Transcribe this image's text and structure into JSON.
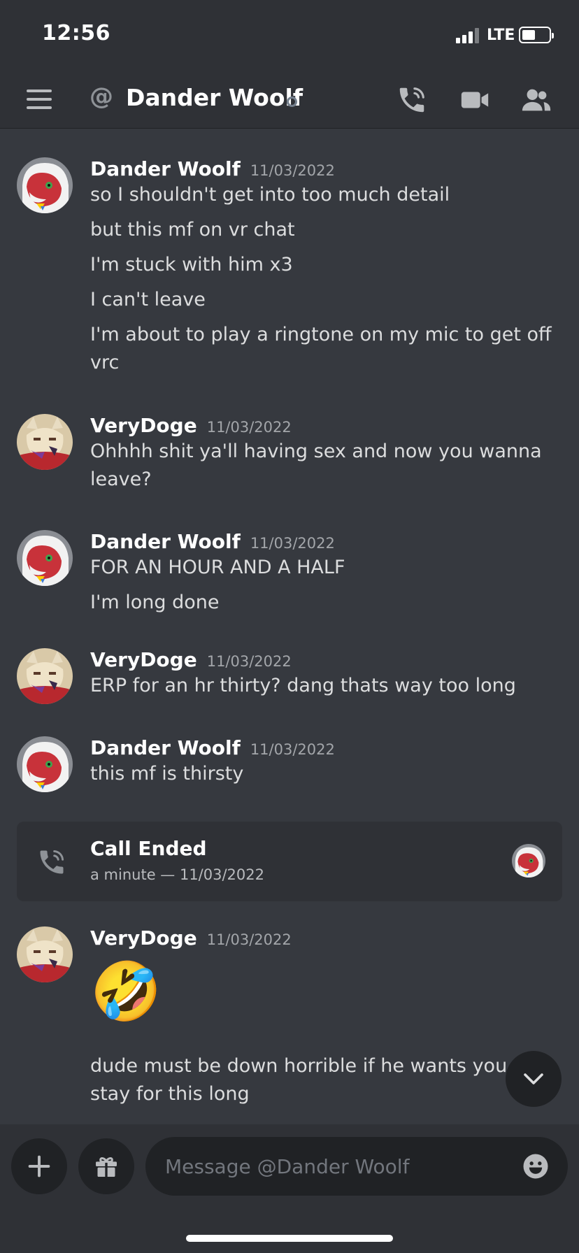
{
  "status_bar": {
    "time": "12:56",
    "network": "LTE"
  },
  "header": {
    "title": "Dander Woolf",
    "at_symbol": "@"
  },
  "colors": {
    "background": "#36393f",
    "header": "#2f3136",
    "input": "#202225",
    "presence_offline": "#747f8d"
  },
  "messages": [
    {
      "author": "Dander Woolf",
      "timestamp": "11/03/2022",
      "lines": [
        "so I shouldn't get into too much detail",
        "but this mf on vr chat",
        "I'm stuck with him x3",
        "I can't leave",
        "I'm about to play a ringtone on my mic to get off vrc"
      ]
    },
    {
      "author": "VeryDoge",
      "timestamp": "11/03/2022",
      "lines": [
        "Ohhhh shit ya'll having sex and now you wanna leave?"
      ]
    },
    {
      "author": "Dander Woolf",
      "timestamp": "11/03/2022",
      "lines": [
        "FOR AN HOUR AND A HALF",
        "I'm long done"
      ]
    },
    {
      "author": "VeryDoge",
      "timestamp": "11/03/2022",
      "lines": [
        "ERP for an hr thirty? dang thats way too long"
      ]
    },
    {
      "author": "Dander Woolf",
      "timestamp": "11/03/2022",
      "lines": [
        "this mf is thirsty"
      ]
    },
    {
      "author": "VeryDoge",
      "timestamp": "11/03/2022",
      "emoji": "🤣",
      "lines": [
        "dude must be down horrible if he wants you to stay for this long"
      ]
    }
  ],
  "call": {
    "title": "Call Ended",
    "subtitle": "a minute — 11/03/2022"
  },
  "composer": {
    "placeholder": "Message @Dander Woolf"
  },
  "icons": [
    "menu-icon",
    "at-icon",
    "voice-call-icon",
    "video-call-icon",
    "members-icon",
    "call-ended-icon",
    "chevron-down-icon",
    "plus-icon",
    "gift-icon",
    "emoji-icon"
  ]
}
